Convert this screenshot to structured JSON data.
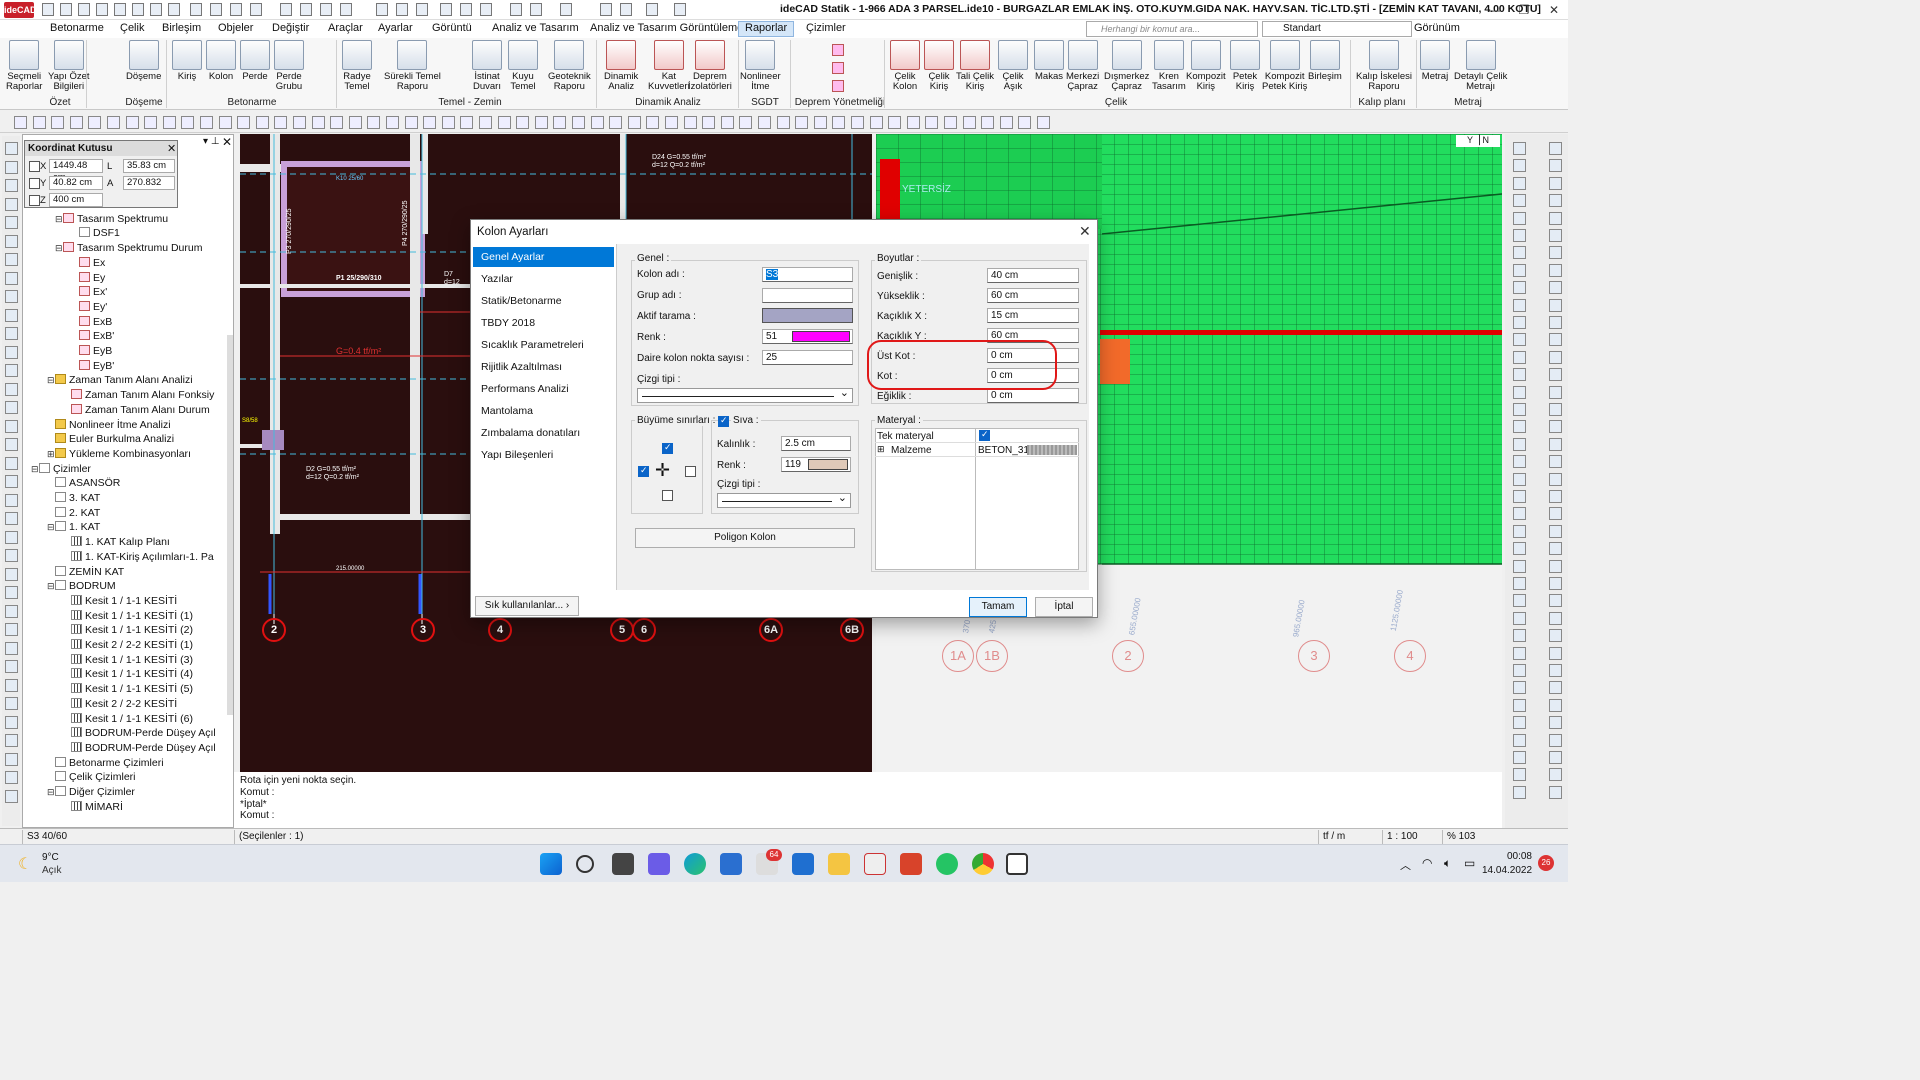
{
  "window": {
    "title": "ideCAD Statik - 1-966 ADA 3 PARSEL.ide10 - BURGAZLAR EMLAK İNŞ. OTO.KUYM.GIDA NAK. HAYV.SAN. TİC.LTD.ŞTİ - [ZEMİN KAT TAVANI,  4.00 KOTU]",
    "logo": "ideCAD"
  },
  "menu": {
    "items": [
      "Betonarme",
      "Çelik",
      "Birleşim",
      "Objeler",
      "Değiştir",
      "Araçlar",
      "Ayarlar",
      "Görüntü",
      "Analiz ve Tasarım",
      "Analiz ve Tasarım Görüntüleme",
      "Raporlar",
      "Çizimler"
    ],
    "active": "Raporlar",
    "search_placeholder": "Herhangi bir komut ara...",
    "profile": "Standart",
    "view": "Görünüm"
  },
  "ribbon": {
    "buttons": [
      {
        "label": "Seçmeli\nRaporlar"
      },
      {
        "label": "Yapı Özet\nBilgileri"
      },
      {
        "label": "Döşeme"
      },
      {
        "label": "Kiriş"
      },
      {
        "label": "Kolon"
      },
      {
        "label": "Perde"
      },
      {
        "label": "Perde\nGrubu"
      },
      {
        "label": "Radye\nTemel"
      },
      {
        "label": "Sürekli Temel\nRaporu"
      },
      {
        "label": "İstinat\nDuvarı"
      },
      {
        "label": "Kuyu\nTemel"
      },
      {
        "label": "Geoteknik\nRaporu"
      },
      {
        "label": "Dinamik\nAnaliz"
      },
      {
        "label": "Kat\nKuvvetleri"
      },
      {
        "label": "Deprem\nİzolatörleri"
      },
      {
        "label": "Nonlineer\nİtme"
      },
      {
        "label": "Çelik\nKolon"
      },
      {
        "label": "Çelik\nKiriş"
      },
      {
        "label": "Tali Çelik\nKiriş"
      },
      {
        "label": "Çelik\nAşık"
      },
      {
        "label": "Makas"
      },
      {
        "label": "Merkezi\nÇapraz"
      },
      {
        "label": "Dışmerkez\nÇapraz"
      },
      {
        "label": "Kren\nTasarım"
      },
      {
        "label": "Kompozit\nKiriş"
      },
      {
        "label": "Petek\nKiriş"
      },
      {
        "label": "Kompozit\nPetek Kiriş"
      },
      {
        "label": "Birleşim"
      },
      {
        "label": "Kalıp İskelesi\nRaporu"
      },
      {
        "label": "Metraj"
      },
      {
        "label": "Detaylı Çelik\nMetrajı"
      }
    ],
    "groups": [
      "Özet",
      "Döşeme",
      "Betonarme",
      "Temel - Zemin",
      "Dinamik Analiz",
      "SGDT",
      "Deprem Yönetmeliği",
      "Çelik",
      "Kalıp planı",
      "Metraj"
    ]
  },
  "coord_box": {
    "title": "Koordinat Kutusu",
    "x_label": "X",
    "x": "1449.48 cm",
    "y_label": "Y",
    "y": "40.82 cm",
    "z_label": "Z",
    "z": "400 cm",
    "l_label": "L",
    "l": "35.83 cm",
    "a_label": "A",
    "a": "270.832"
  },
  "tree": {
    "rows": [
      {
        "t": "nalizi",
        "lvl": 9,
        "icon": "page"
      },
      {
        "t": "Tasarım Spektrumu",
        "lvl": 4,
        "icon": "chart",
        "exp": "⊟"
      },
      {
        "t": "DSF1",
        "lvl": 6,
        "icon": "page"
      },
      {
        "t": "Tasarım Spektrumu Durum",
        "lvl": 4,
        "icon": "chart",
        "exp": "⊟"
      },
      {
        "t": "Ex",
        "lvl": 6,
        "icon": "chart"
      },
      {
        "t": "Ey",
        "lvl": 6,
        "icon": "chart"
      },
      {
        "t": "Ex'",
        "lvl": 6,
        "icon": "chart"
      },
      {
        "t": "Ey'",
        "lvl": 6,
        "icon": "chart"
      },
      {
        "t": "ExB",
        "lvl": 6,
        "icon": "chart"
      },
      {
        "t": "ExB'",
        "lvl": 6,
        "icon": "chart"
      },
      {
        "t": "EyB",
        "lvl": 6,
        "icon": "chart"
      },
      {
        "t": "EyB'",
        "lvl": 6,
        "icon": "chart"
      },
      {
        "t": "Zaman Tanım Alanı Analizi",
        "lvl": 3,
        "icon": "folder",
        "exp": "⊟"
      },
      {
        "t": "Zaman Tanım Alanı Fonksiy",
        "lvl": 5,
        "icon": "chart"
      },
      {
        "t": "Zaman Tanım Alanı Durum",
        "lvl": 5,
        "icon": "chart"
      },
      {
        "t": "Nonlineer İtme Analizi",
        "lvl": 3,
        "icon": "folder"
      },
      {
        "t": "Euler Burkulma Analizi",
        "lvl": 3,
        "icon": "folder"
      },
      {
        "t": "Yükleme Kombinasyonları",
        "lvl": 3,
        "icon": "folder",
        "exp": "⊞"
      },
      {
        "t": "Çizimler",
        "lvl": 1,
        "icon": "page",
        "exp": "⊟"
      },
      {
        "t": "ASANSÖR",
        "lvl": 3,
        "icon": "page"
      },
      {
        "t": "3. KAT",
        "lvl": 3,
        "icon": "page"
      },
      {
        "t": "2. KAT",
        "lvl": 3,
        "icon": "page"
      },
      {
        "t": "1. KAT",
        "lvl": 3,
        "icon": "page",
        "exp": "⊟"
      },
      {
        "t": "1. KAT Kalıp Planı",
        "lvl": 5,
        "icon": "grid"
      },
      {
        "t": "1. KAT-Kiriş Açılımları-1. Pa",
        "lvl": 5,
        "icon": "grid"
      },
      {
        "t": "ZEMİN KAT",
        "lvl": 3,
        "icon": "page"
      },
      {
        "t": "BODRUM",
        "lvl": 3,
        "icon": "page",
        "exp": "⊟"
      },
      {
        "t": "Kesit 1 / 1-1 KESİTİ",
        "lvl": 5,
        "icon": "grid"
      },
      {
        "t": "Kesit 1 / 1-1 KESİTİ (1)",
        "lvl": 5,
        "icon": "grid"
      },
      {
        "t": "Kesit 1 / 1-1 KESİTİ (2)",
        "lvl": 5,
        "icon": "grid"
      },
      {
        "t": "Kesit 2 / 2-2 KESİTİ (1)",
        "lvl": 5,
        "icon": "grid"
      },
      {
        "t": "Kesit 1 / 1-1 KESİTİ (3)",
        "lvl": 5,
        "icon": "grid"
      },
      {
        "t": "Kesit 1 / 1-1 KESİTİ (4)",
        "lvl": 5,
        "icon": "grid"
      },
      {
        "t": "Kesit 1 / 1-1 KESİTİ (5)",
        "lvl": 5,
        "icon": "grid"
      },
      {
        "t": "Kesit 2 / 2-2 KESİTİ",
        "lvl": 5,
        "icon": "grid"
      },
      {
        "t": "Kesit 1 / 1-1 KESİTİ (6)",
        "lvl": 5,
        "icon": "grid"
      },
      {
        "t": "BODRUM-Perde Düşey Açıl",
        "lvl": 5,
        "icon": "grid"
      },
      {
        "t": "BODRUM-Perde Düşey Açıl",
        "lvl": 5,
        "icon": "grid"
      },
      {
        "t": "Betonarme Çizimleri",
        "lvl": 3,
        "icon": "page"
      },
      {
        "t": "Çelik Çizimleri",
        "lvl": 3,
        "icon": "page"
      },
      {
        "t": "Diğer Çizimler",
        "lvl": 3,
        "icon": "page",
        "exp": "⊟"
      },
      {
        "t": "MİMARİ",
        "lvl": 5,
        "icon": "grid"
      }
    ]
  },
  "cad_left": {
    "labels": {
      "col_p3": "P3 270/290/25",
      "col_p4": "P4 270/290/25",
      "col_p1": "P1 25/290/310",
      "load1": "G=0.4 tf/m²",
      "beam_k10": "K10 25/60",
      "d24_label": "D24",
      "d24_load": "G=0.55 tf/m²",
      "d24_d": "d=12",
      "d24_q": "Q=0.2 tf/m²",
      "d2_label": "D2",
      "d2_load": "G=0.55 tf/m²",
      "d2_d": "d=12",
      "d2_q": "Q=0.2 tf/m²",
      "d7_label": "D7",
      "d7_d": "d=12",
      "s_label": "S8/58",
      "dim1": "215.00000"
    },
    "axes": [
      "2",
      "3",
      "4",
      "5",
      "6",
      "6A",
      "6B"
    ]
  },
  "cad_right": {
    "overlay": "YETERSİZ",
    "axes": [
      "1A",
      "1B",
      "2",
      "3",
      "4"
    ],
    "dims": [
      "370",
      "425",
      "655.00000",
      "965.00000",
      "1125.00000"
    ]
  },
  "command": {
    "line1": "Rota için yeni nokta seçin.",
    "line2": "Komut :",
    "line3": "*İptal*",
    "line4": "Komut :"
  },
  "status": {
    "left": "S3 40/60",
    "sel": "(Seçilenler : 1)",
    "unit": "tf / m",
    "scale": "1 : 100",
    "zoom": "% 103"
  },
  "taskbar": {
    "weather_temp": "9°C",
    "weather_state": "Açık",
    "time": "00:08",
    "date": "14.04.2022",
    "badge_mail": "64",
    "badge_notif": "26"
  },
  "dialog": {
    "title": "Kolon Ayarları",
    "nav": [
      "Genel Ayarlar",
      "Yazılar",
      "Statik/Betonarme",
      "TBDY 2018",
      "Sıcaklık Parametreleri",
      "Rijitlik Azaltılması",
      "Performans Analizi",
      "Mantolama",
      "Zımbalama donatıları",
      "Yapı Bileşenleri"
    ],
    "nav_selected": 0,
    "frequent": "Sık kullanılanlar...",
    "genel": {
      "title": "Genel :",
      "kolon_adi_label": "Kolon adı :",
      "kolon_adi": "S3",
      "grup_label": "Grup adı :",
      "tarama_label": "Aktif tarama :",
      "renk_label": "Renk :",
      "renk_val": "51",
      "renk_color": "#ff00ff",
      "daire_label": "Daire kolon nokta sayısı :",
      "daire_val": "25",
      "cizgi_label": "Çizgi tipi :"
    },
    "boyutlar": {
      "title": "Boyutlar :",
      "genislik_label": "Genişlik :",
      "genislik": "40 cm",
      "yukseklik_label": "Yükseklik :",
      "yukseklik": "60 cm",
      "kacx_label": "Kaçıklık X :",
      "kacx": "15 cm",
      "kacy_label": "Kaçıklık Y :",
      "kacy": "60 cm",
      "ustkot_label": "Üst Kot :",
      "ustkot": "0 cm",
      "kot_label": "Kot :",
      "kot": "0 cm",
      "egiklik_label": "Eğiklik :",
      "egiklik": "0 cm"
    },
    "buyume": {
      "title": "Büyüme sınırları :"
    },
    "siva": {
      "title": "Sıva :",
      "kalinlik_label": "Kalınlık :",
      "kalinlik": "2.5 cm",
      "renk_label": "Renk :",
      "renk_val": "119",
      "renk_color": "#dfc9b8",
      "cizgi_label": "Çizgi tipi :"
    },
    "poligon": "Poligon Kolon",
    "materyal": {
      "title": "Materyal :",
      "tek_label": "Tek materyal",
      "malzeme_label": "Malzeme",
      "malzeme": "BETON_31"
    },
    "ok": "Tamam",
    "cancel": "İptal"
  }
}
